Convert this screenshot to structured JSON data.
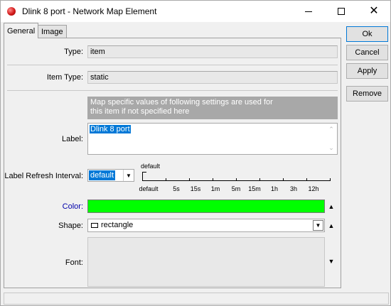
{
  "window": {
    "title": "Dlink 8 port - Network Map Element",
    "minimize_glyph": "minimize-icon",
    "maximize_glyph": "maximize-icon",
    "close_glyph": "✕"
  },
  "tabs": [
    {
      "label": "General",
      "active": true
    },
    {
      "label": "Image",
      "active": false
    }
  ],
  "fields": {
    "type": {
      "label": "Type:",
      "value": "item"
    },
    "item_type": {
      "label": "Item Type:",
      "value": "static"
    },
    "info_text_line1": "Map specific values of following settings are used for",
    "info_text_line2": "this item if not specified here",
    "label": {
      "label": "Label:",
      "value": "Dlink 8 port"
    },
    "label_refresh": {
      "label": "Label Refresh Interval:",
      "value": "default",
      "slider_current": "default",
      "ticks": [
        "default",
        "5s",
        "15s",
        "1m",
        "5m",
        "15m",
        "1h",
        "3h",
        "12h"
      ]
    },
    "color": {
      "label": "Color:",
      "value": "#00ff00",
      "label_color": "#0000aa"
    },
    "shape": {
      "label": "Shape:",
      "value": "rectangle"
    },
    "font": {
      "label": "Font:"
    }
  },
  "buttons": {
    "ok": "Ok",
    "cancel": "Cancel",
    "apply": "Apply",
    "remove": "Remove"
  }
}
